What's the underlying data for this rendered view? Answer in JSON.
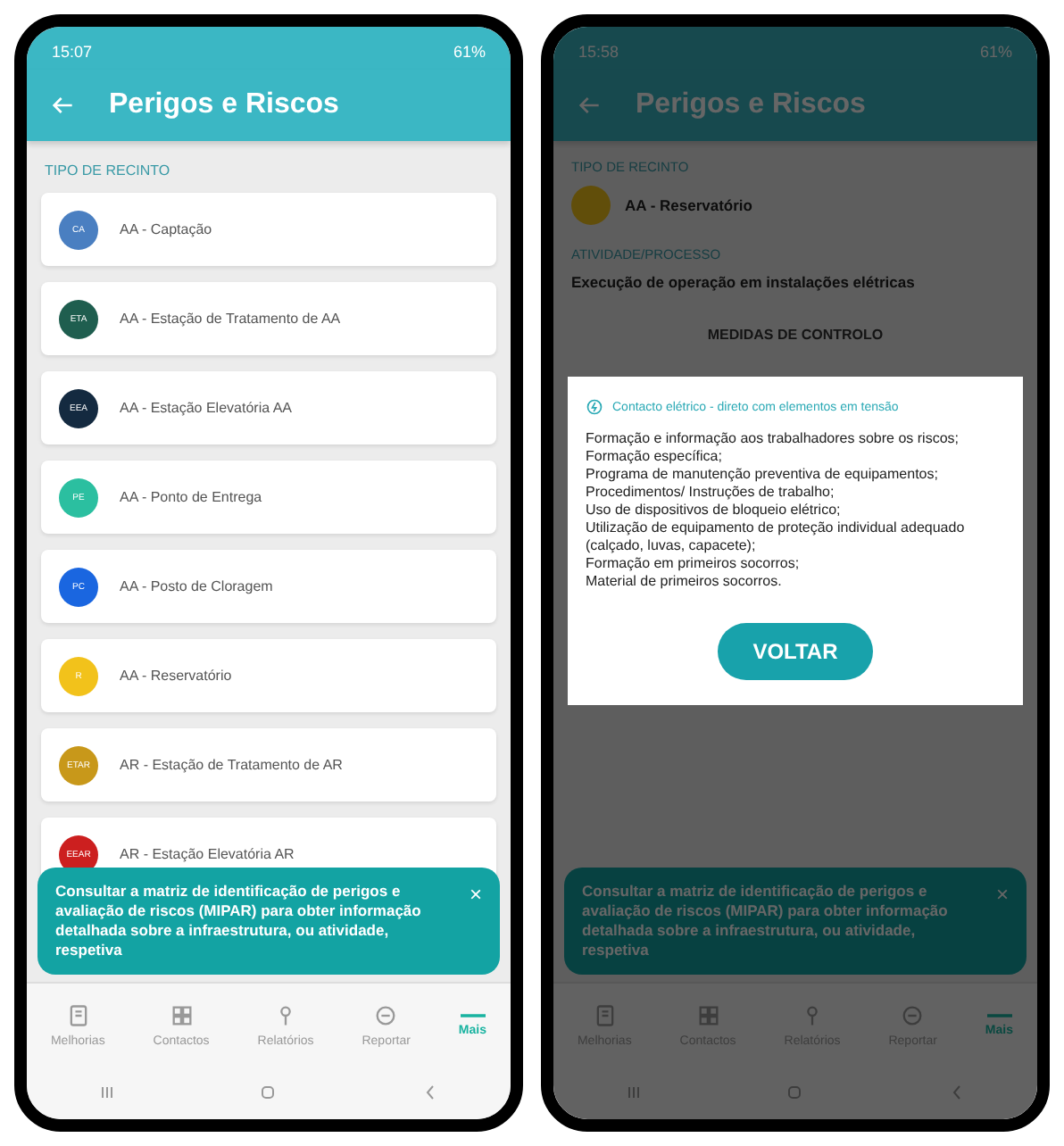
{
  "screens": [
    {
      "kind": "list",
      "status_bar": {
        "time": "15:07",
        "battery": "61%"
      },
      "header": {
        "title": "Perigos e Riscos"
      },
      "section_label": "TIPO DE RECINTO",
      "items": [
        {
          "code": "CA",
          "label": "AA - Captação",
          "color": "#4a7fc1"
        },
        {
          "code": "ETA",
          "label": "AA - Estação de Tratamento de AA",
          "color": "#1f5e4f"
        },
        {
          "code": "EEA",
          "label": "AA - Estação Elevatória AA",
          "color": "#142a40"
        },
        {
          "code": "PE",
          "label": "AA - Ponto de Entrega",
          "color": "#2bbfa0"
        },
        {
          "code": "PC",
          "label": "AA - Posto de Cloragem",
          "color": "#1a66e0"
        },
        {
          "code": "R",
          "label": "AA - Reservatório",
          "color": "#f2c21b"
        },
        {
          "code": "ETAR",
          "label": "AR - Estação de Tratamento de AR",
          "color": "#c8981a"
        },
        {
          "code": "EEAR",
          "label": "AR - Estação Elevatória AR",
          "color": "#cc1f1f"
        }
      ],
      "banner": {
        "text": "Consultar a matriz de identificação de perigos e avaliação de riscos (MIPAR) para obter informação detalhada sobre a infraestrutura, ou atividade, respetiva",
        "close": "×"
      },
      "nav": [
        {
          "label": "Melhorias",
          "selected": false
        },
        {
          "label": "Contactos",
          "selected": false
        },
        {
          "label": "Relatórios",
          "selected": false
        },
        {
          "label": "Reportar",
          "selected": false
        },
        {
          "label": "Mais",
          "selected": true
        }
      ]
    },
    {
      "kind": "detail",
      "status_bar": {
        "time": "15:58",
        "battery": "61%"
      },
      "header": {
        "title": "Perigos e Riscos"
      },
      "fields": [
        {
          "label": "TIPO DE RECINTO",
          "value": "AA - Reservatório",
          "avatar": true
        },
        {
          "label": "ATIVIDADE/PROCESSO",
          "value": "Execução de operação em instalações elétricas",
          "avatar": false
        }
      ],
      "section_title": "MEDIDAS DE CONTROLO",
      "dialog": {
        "title": "Contacto elétrico - direto com elementos em tensão",
        "lines": [
          "Formação e informação aos trabalhadores sobre os riscos;",
          "Formação específica;",
          "Programa de manutenção preventiva de equipamentos;",
          "Procedimentos/ Instruções de trabalho;",
          "Uso de dispositivos de bloqueio elétrico;",
          "Utilização de equipamento de proteção individual adequado (calçado, luvas, capacete);",
          "Formação em primeiros socorros;",
          "Material de primeiros socorros."
        ],
        "button": "VOLTAR"
      },
      "banner": {
        "text": "Consultar a matriz de identificação de perigos e avaliação de riscos (MIPAR) para obter informação detalhada sobre a infraestrutura, ou atividade, respetiva",
        "close": "×"
      },
      "nav": [
        {
          "label": "Melhorias",
          "selected": false
        },
        {
          "label": "Contactos",
          "selected": false
        },
        {
          "label": "Relatórios",
          "selected": false
        },
        {
          "label": "Reportar",
          "selected": false
        },
        {
          "label": "Mais",
          "selected": true
        }
      ]
    }
  ]
}
